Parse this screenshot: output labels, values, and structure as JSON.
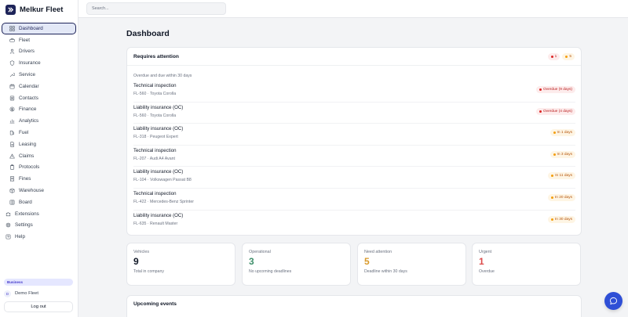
{
  "app": {
    "name": "Melkur Fleet"
  },
  "search": {
    "placeholder": "Search..."
  },
  "sidebar": {
    "items": [
      {
        "label": "Dashboard",
        "icon": "grid-icon",
        "active": true
      },
      {
        "label": "Fleet",
        "icon": "car-icon"
      },
      {
        "label": "Drivers",
        "icon": "user-icon"
      },
      {
        "label": "Insurance",
        "icon": "shield-icon"
      },
      {
        "label": "Service",
        "icon": "wrench-icon"
      },
      {
        "label": "Calendar",
        "icon": "calendar-icon"
      },
      {
        "label": "Contacts",
        "icon": "contacts-icon"
      },
      {
        "label": "Finance",
        "icon": "dollar-icon"
      },
      {
        "label": "Analytics",
        "icon": "chart-icon"
      },
      {
        "label": "Fuel",
        "icon": "fuel-icon"
      },
      {
        "label": "Leasing",
        "icon": "document-icon"
      },
      {
        "label": "Claims",
        "icon": "warning-icon"
      },
      {
        "label": "Protocols",
        "icon": "clipboard-icon"
      },
      {
        "label": "Fines",
        "icon": "receipt-icon"
      },
      {
        "label": "Warehouse",
        "icon": "box-icon"
      },
      {
        "label": "Board",
        "icon": "board-icon"
      }
    ],
    "extra": [
      {
        "label": "Extensions",
        "icon": "puzzle-icon"
      },
      {
        "label": "Settings",
        "icon": "gear-icon"
      },
      {
        "label": "Help",
        "icon": "help-icon"
      }
    ],
    "plan": "Business",
    "org": {
      "initial": "D",
      "name": "Demo Fleet"
    },
    "logout": "Log out"
  },
  "page": {
    "title": "Dashboard"
  },
  "attention": {
    "title": "Requires attention",
    "badge_red": "1",
    "badge_amber": "5",
    "section_label": "Overdue and due within 30 days",
    "items": [
      {
        "title": "Technical inspection",
        "sub": "FL-560 · Toyota Corolla",
        "status": "Overdue (9 days)",
        "level": "red"
      },
      {
        "title": "Liability insurance (OC)",
        "sub": "FL-560 · Toyota Corolla",
        "status": "Overdue (4 days)",
        "level": "red"
      },
      {
        "title": "Liability insurance (OC)",
        "sub": "FL-318 · Peugeot Expert",
        "status": "In 1 days",
        "level": "amber"
      },
      {
        "title": "Technical inspection",
        "sub": "FL-207 · Audi A4 Avant",
        "status": "In 3 days",
        "level": "amber"
      },
      {
        "title": "Liability insurance (OC)",
        "sub": "FL-104 · Volkswagen Passat B8",
        "status": "In 11 days",
        "level": "amber"
      },
      {
        "title": "Technical inspection",
        "sub": "FL-422 · Mercedes-Benz Sprinter",
        "status": "In 20 days",
        "level": "amber"
      },
      {
        "title": "Liability insurance (OC)",
        "sub": "FL-635 · Renault Master",
        "status": "In 30 days",
        "level": "amber"
      }
    ]
  },
  "stats": [
    {
      "label": "Vehicles",
      "value": "9",
      "sub": "Total in company",
      "color": "#111827"
    },
    {
      "label": "Operational",
      "value": "3",
      "sub": "No upcoming deadlines",
      "color": "#3f8f6b"
    },
    {
      "label": "Need attention",
      "value": "5",
      "sub": "Deadline within 30 days",
      "color": "#d99a2b"
    },
    {
      "label": "Urgent",
      "value": "1",
      "sub": "Overdue",
      "color": "#dc4b4b"
    }
  ],
  "upcoming": {
    "title": "Upcoming events"
  },
  "colors": {
    "brand": "#1e2459",
    "accent": "#2f4fd6",
    "danger": "#dc2626",
    "warning": "#f59e0b"
  }
}
